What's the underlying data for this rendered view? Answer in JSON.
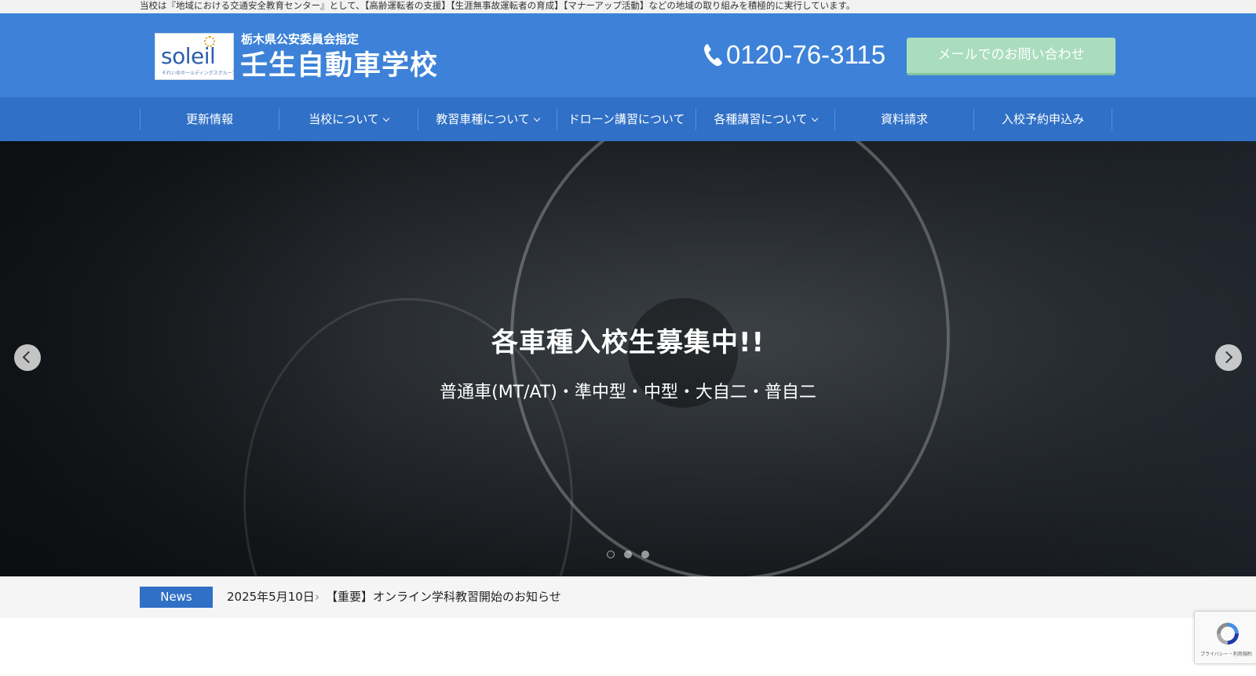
{
  "topbar": {
    "text": "当校は『地域における交通安全教育センター』として、【高齢運転者の支援】【生涯無事故運転者の育成】【マナーアップ活動】などの地域の取り組みを積極的に実行しています。"
  },
  "header": {
    "logo_text": "soleil",
    "logo_sub": "それいゆホールディングスグループ",
    "designation": "栃木県公安委員会指定",
    "school_name": "壬生自動車学校",
    "phone": "0120-76-3115",
    "mail_button": "メールでのお問い合わせ"
  },
  "nav": {
    "items": [
      {
        "label": "更新情報"
      },
      {
        "label": "当校について"
      },
      {
        "label": "教習車種について"
      },
      {
        "label": "ドローン講習について"
      },
      {
        "label": "各種講習について"
      },
      {
        "label": "資料請求"
      },
      {
        "label": "入校予約申込み"
      }
    ]
  },
  "hero": {
    "title": "各車種入校生募集中!!",
    "subtitle": "普通車(MT/AT)・準中型・中型・大自二・普自二",
    "slide_count": 3,
    "active_slide": 1
  },
  "news": {
    "badge": "News",
    "date": "2025年5月10日",
    "separator": "›",
    "title": "【重要】オンライン学科教習開始のお知らせ"
  },
  "recaptcha": {
    "footer": "プライバシー・利用規約"
  },
  "colors": {
    "header_blue": "#3d82d8",
    "nav_blue": "#3070c6",
    "mail_green": "#a9ddbe"
  }
}
